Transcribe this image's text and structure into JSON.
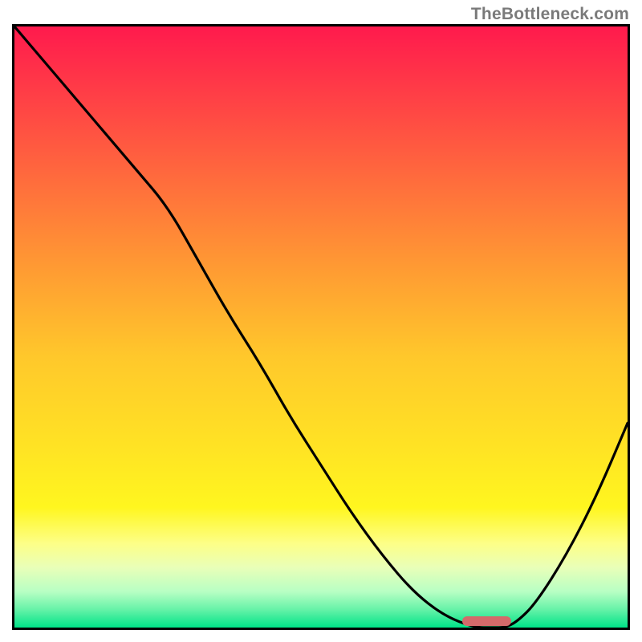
{
  "watermark": "TheBottleneck.com",
  "colors": {
    "frame": "#000000",
    "curve": "#000000",
    "marker": "#d46a6a",
    "gradient_stops": [
      {
        "offset": 0.0,
        "color": "#ff1a4d"
      },
      {
        "offset": 0.1,
        "color": "#ff3a47"
      },
      {
        "offset": 0.25,
        "color": "#ff6a3d"
      },
      {
        "offset": 0.4,
        "color": "#ff9a33"
      },
      {
        "offset": 0.55,
        "color": "#ffc82b"
      },
      {
        "offset": 0.7,
        "color": "#ffe324"
      },
      {
        "offset": 0.8,
        "color": "#fff61f"
      },
      {
        "offset": 0.86,
        "color": "#fdff87"
      },
      {
        "offset": 0.9,
        "color": "#e9ffb8"
      },
      {
        "offset": 0.94,
        "color": "#b8ffc4"
      },
      {
        "offset": 0.97,
        "color": "#66f2a8"
      },
      {
        "offset": 1.0,
        "color": "#00e388"
      }
    ]
  },
  "chart_data": {
    "type": "line",
    "title": "",
    "xlabel": "",
    "ylabel": "",
    "xlim": [
      0,
      100
    ],
    "ylim": [
      0,
      100
    ],
    "series": [
      {
        "name": "curve",
        "x": [
          0,
          5,
          10,
          15,
          20,
          25,
          30,
          35,
          40,
          45,
          50,
          55,
          60,
          65,
          70,
          75,
          78,
          80,
          82,
          85,
          90,
          95,
          100
        ],
        "y": [
          100,
          94,
          88,
          82,
          76,
          70,
          61,
          52,
          44,
          35,
          27,
          19,
          12,
          6,
          2,
          0,
          0,
          0,
          1,
          4,
          12,
          22,
          34
        ]
      }
    ],
    "marker": {
      "x_start": 73,
      "x_end": 81,
      "y": 0
    },
    "note": "y-values are relative (0 = bottom/green, 100 = top/red); curve descends from top-left, bottoms out around x≈75–80, then rises toward the right edge."
  }
}
